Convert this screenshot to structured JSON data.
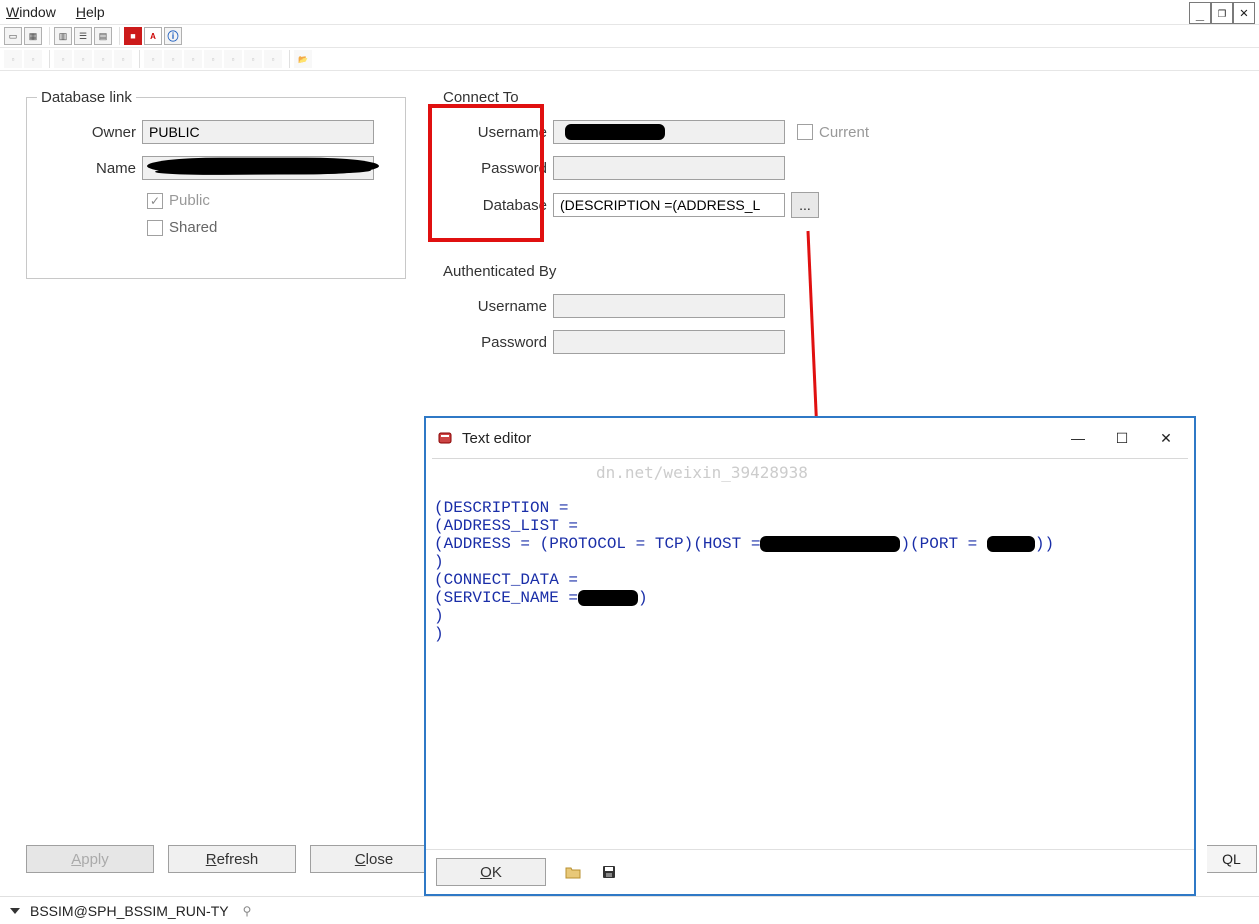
{
  "menu": {
    "window": "Window",
    "help": "Help"
  },
  "window_controls": {
    "min": "_",
    "max": "❐",
    "close": "✕"
  },
  "groups": {
    "dblink": {
      "legend": "Database link",
      "owner_label": "Owner",
      "owner_value": "PUBLIC",
      "name_label": "Name",
      "name_value": "",
      "public_label": "Public",
      "shared_label": "Shared"
    },
    "connect": {
      "legend": "Connect To",
      "username_label": "Username",
      "username_value": "",
      "password_label": "Password",
      "password_value": "",
      "database_label": "Database",
      "database_value": "(DESCRIPTION =(ADDRESS_L",
      "current_label": "Current",
      "ellipsis": "..."
    },
    "auth": {
      "legend": "Authenticated By",
      "username_label": "Username",
      "username_value": "",
      "password_label": "Password",
      "password_value": ""
    }
  },
  "buttons": {
    "apply": "Apply",
    "refresh": "Refresh",
    "close": "Close",
    "ql": "QL"
  },
  "status": "BSSIM@SPH_BSSIM_RUN-TY",
  "dialog": {
    "title": "Text editor",
    "watermark": "dn.net/weixin_39428938",
    "lines": [
      "(DESCRIPTION =",
      "(ADDRESS_LIST =",
      "(ADDRESS = (PROTOCOL = TCP)(HOST =________)(PORT = ____))",
      ")",
      "(CONNECT_DATA =",
      "(SERVICE_NAME =____)",
      ")",
      ")"
    ],
    "ok": "OK",
    "controls": {
      "min": "—",
      "max": "☐",
      "close": "✕"
    }
  }
}
